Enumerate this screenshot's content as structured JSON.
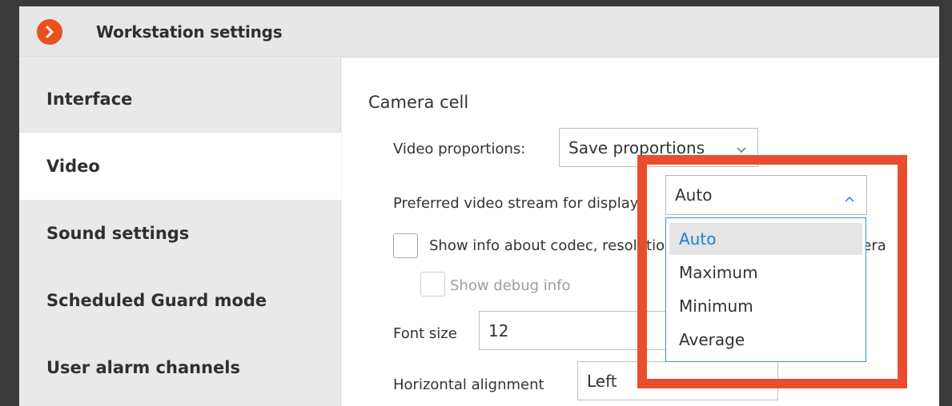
{
  "window": {
    "title": "Workstation settings"
  },
  "sidebar": {
    "items": [
      {
        "label": "Interface",
        "active": false
      },
      {
        "label": "Video",
        "active": true
      },
      {
        "label": "Sound settings",
        "active": false
      },
      {
        "label": "Scheduled Guard mode",
        "active": false
      },
      {
        "label": "User alarm channels",
        "active": false
      }
    ]
  },
  "camera_cell": {
    "section_title": "Camera cell",
    "video_proportions_label": "Video proportions:",
    "video_proportions_value": "Save proportions",
    "preferred_stream_label": "Preferred video stream for display",
    "preferred_stream_value": "Auto",
    "preferred_stream_options": [
      "Auto",
      "Maximum",
      "Minimum",
      "Average"
    ],
    "preferred_stream_selected_index": 0,
    "show_info_label": "Show info about codec, resolution, bitrate and fps from camera",
    "show_info_checked": false,
    "show_debug_label": "Show debug info",
    "show_debug_checked": false,
    "font_size_label": "Font size",
    "font_size_value": "12",
    "horizontal_alignment_label": "Horizontal alignment",
    "horizontal_alignment_value": "Left"
  },
  "colors": {
    "accent": "#e9501e",
    "highlight_box": "#e84e2e",
    "selection_text": "#1e7fd0",
    "focus_border": "#3b8fd8"
  }
}
